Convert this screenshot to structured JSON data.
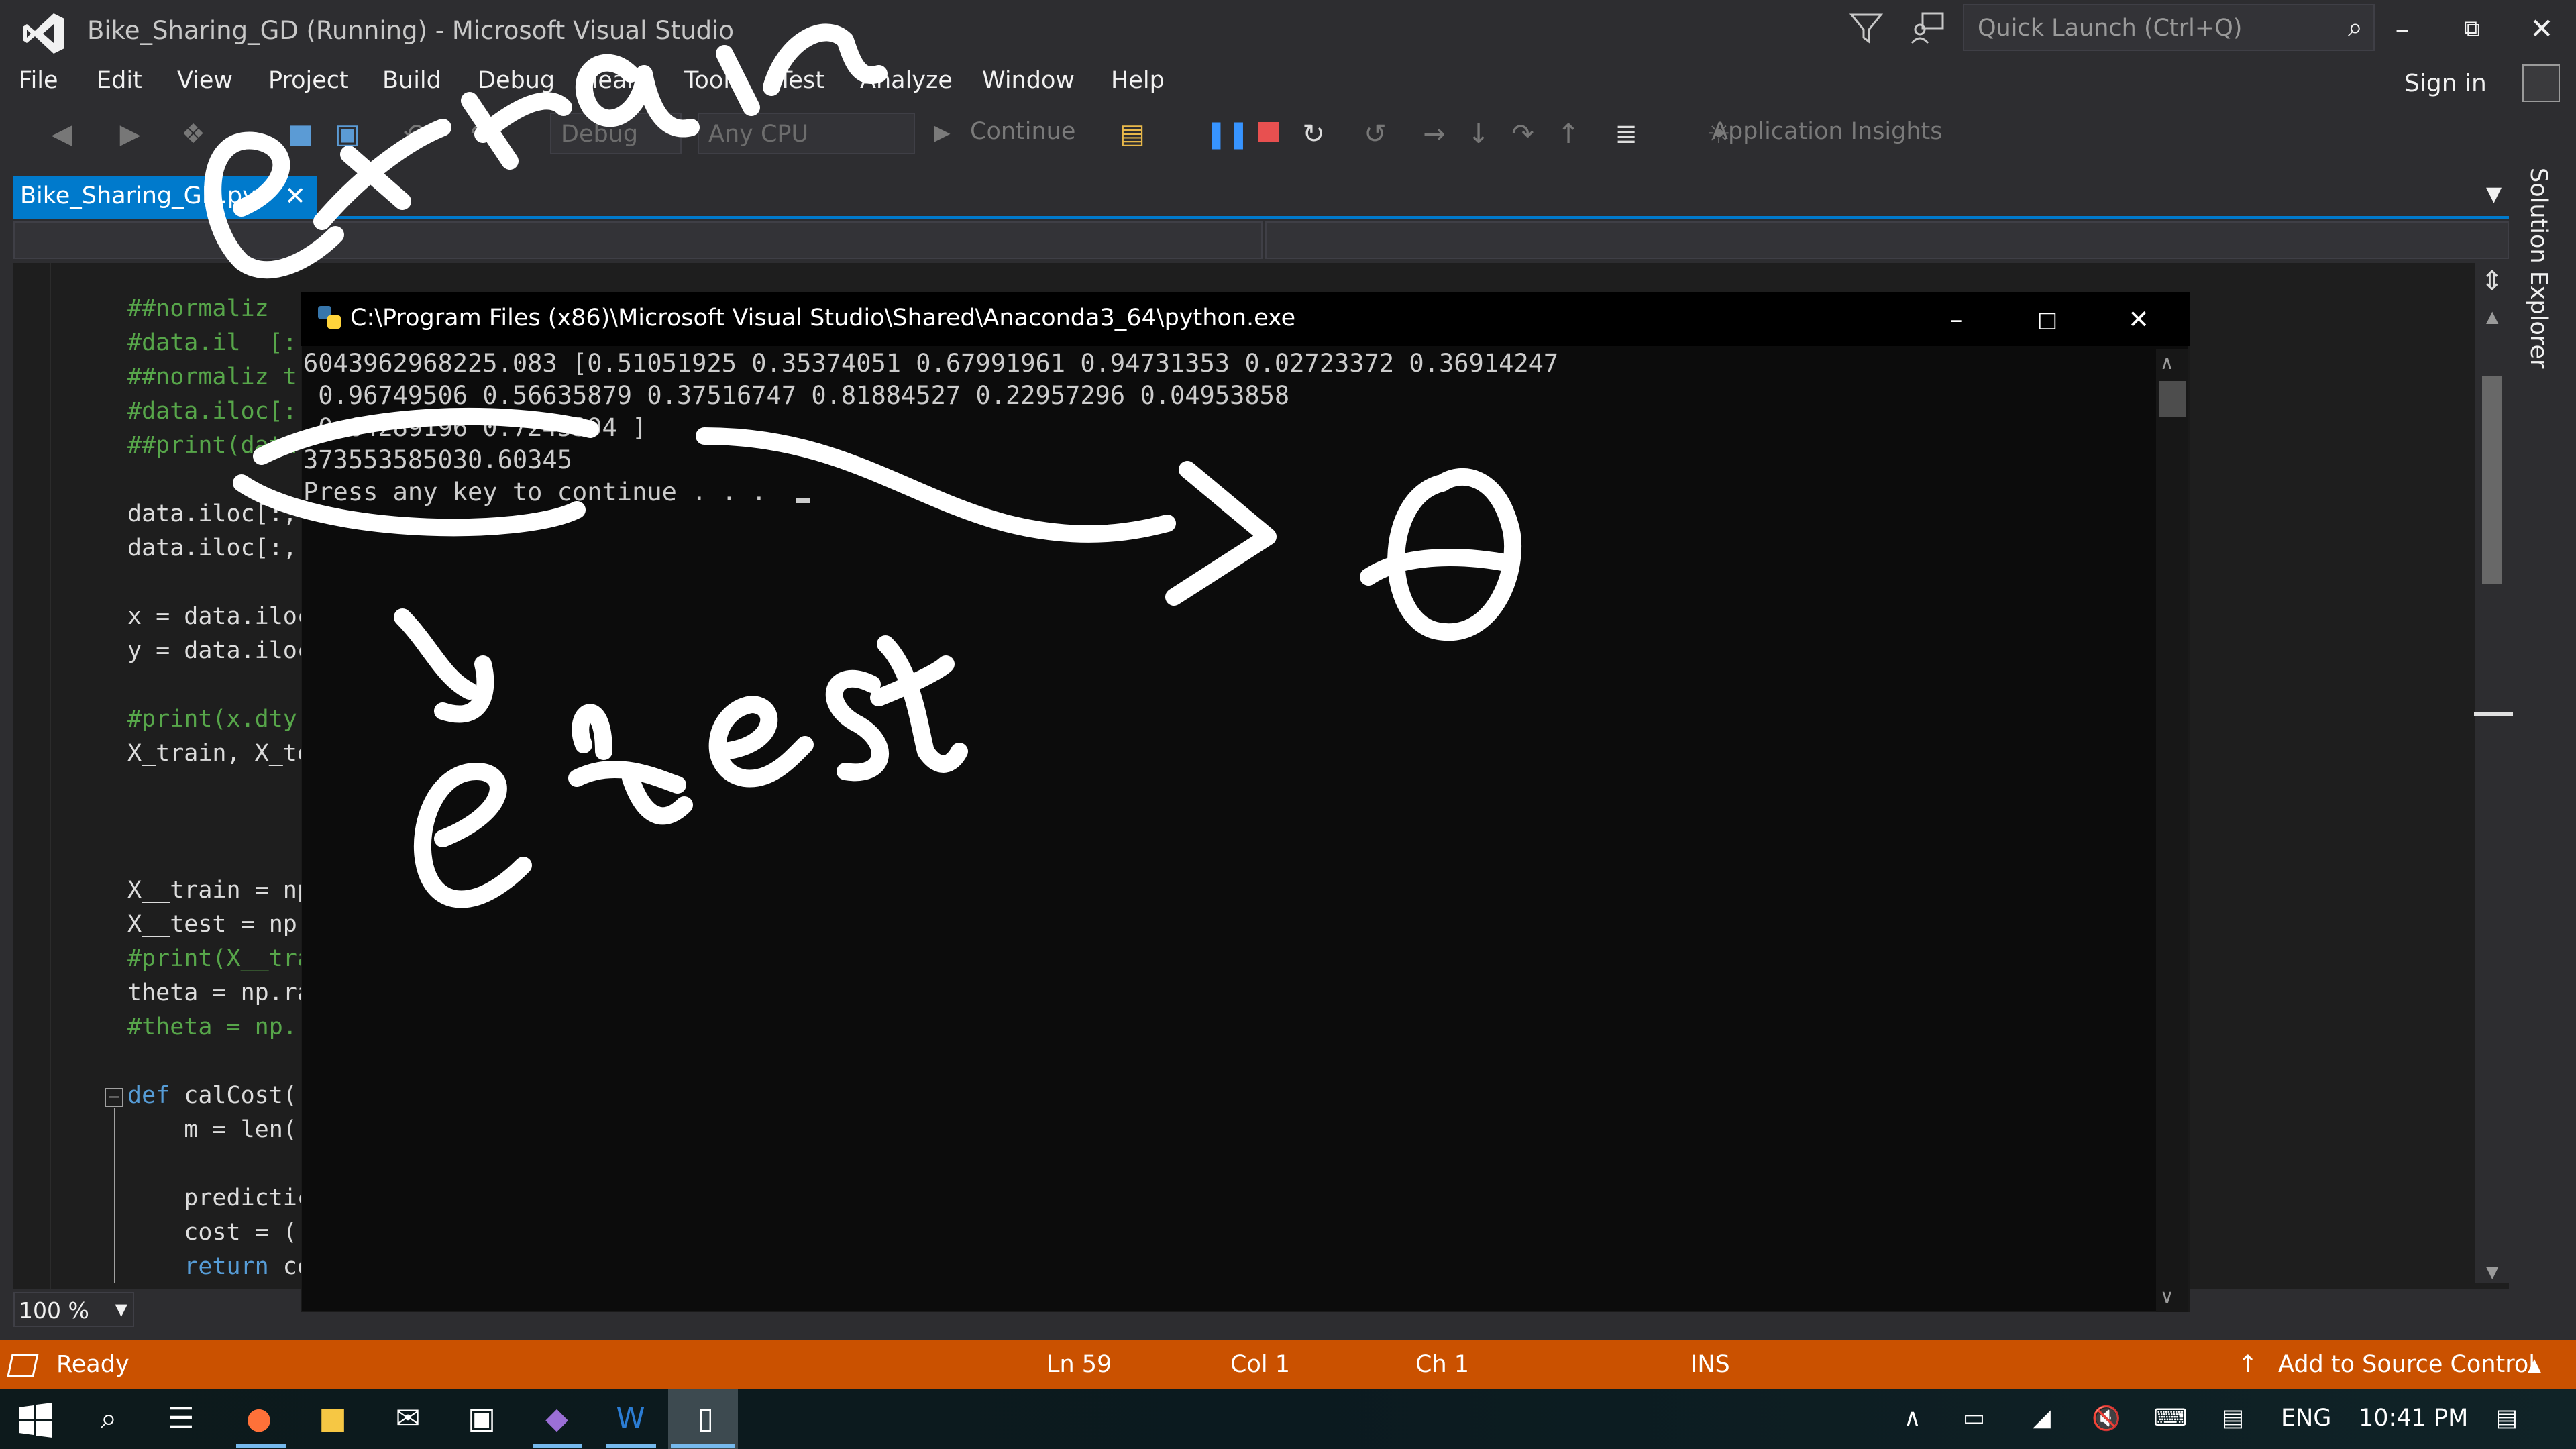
{
  "window": {
    "title": "Bike_Sharing_GD (Running) - Microsoft Visual Studio",
    "quick_launch_placeholder": "Quick Launch (Ctrl+Q)",
    "sign_in": "Sign in"
  },
  "menu": [
    "File",
    "Edit",
    "View",
    "Project",
    "Build",
    "Debug",
    "Team",
    "Tools",
    "Test",
    "Analyze",
    "Window",
    "Help"
  ],
  "toolbar": {
    "config": "Debug",
    "platform": "Any CPU",
    "continue": "Continue",
    "app_insights": "Application Insights"
  },
  "tab": {
    "label": "Bike_Sharing_GD.py"
  },
  "solution_explorer": "Solution Explorer",
  "code_lines": [
    {
      "text": "##normaliz",
      "kind": "comment"
    },
    {
      "text": "#data.il  [:",
      "kind": "comment"
    },
    {
      "text": "##normaliz t",
      "kind": "comment"
    },
    {
      "text": "#data.iloc[:",
      "kind": "comment"
    },
    {
      "text": "##print(data",
      "kind": "comment"
    },
    {
      "text": "",
      "kind": "plain"
    },
    {
      "text": "data.iloc[:,",
      "kind": "plain"
    },
    {
      "text": "data.iloc[:,",
      "kind": "plain"
    },
    {
      "text": "",
      "kind": "plain"
    },
    {
      "text": "x = data.iloc",
      "kind": "plain"
    },
    {
      "text": "y = data.iloc",
      "kind": "plain"
    },
    {
      "text": "",
      "kind": "plain"
    },
    {
      "text": "#print(x.dty",
      "kind": "comment"
    },
    {
      "text": "X_train, X_te",
      "kind": "plain"
    },
    {
      "text": "",
      "kind": "plain"
    },
    {
      "text": "",
      "kind": "plain"
    },
    {
      "text": "",
      "kind": "plain"
    },
    {
      "text": "X__train = np",
      "kind": "plain"
    },
    {
      "text": "X__test = np.",
      "kind": "plain"
    },
    {
      "text": "#print(X__tra",
      "kind": "comment"
    },
    {
      "text": "theta = np.ra",
      "kind": "plain"
    },
    {
      "text": "#theta = np.",
      "kind": "comment"
    },
    {
      "text": "",
      "kind": "plain"
    },
    {
      "text": "def calCost(",
      "kind": "def"
    },
    {
      "text": "    m = len(",
      "kind": "plain"
    },
    {
      "text": "",
      "kind": "plain"
    },
    {
      "text": "    predictic",
      "kind": "plain"
    },
    {
      "text": "    cost = (",
      "kind": "plain"
    },
    {
      "text": "    return co",
      "kind": "return"
    }
  ],
  "zoom": "100 %",
  "console": {
    "title": "C:\\Program Files (x86)\\Microsoft Visual Studio\\Shared\\Anaconda3_64\\python.exe",
    "lines": [
      "6043962968225.083 [0.51051925 0.35374051 0.67991961 0.94731353 0.02723372 0.36914247",
      " 0.96749506 0.56635879 0.37516747 0.81884527 0.22957296 0.04953858",
      " 0.64289196 0.7245394 ]",
      "373553585030.60345",
      "Press any key to continue . . . "
    ]
  },
  "status": {
    "ready": "Ready",
    "ln": "Ln 59",
    "col": "Col 1",
    "ch": "Ch 1",
    "ins": "INS",
    "source_control": "Add to Source Control"
  },
  "taskbar": {
    "lang": "ENG",
    "time": "10:41 PM"
  },
  "colors": {
    "accent": "#007acc",
    "status_bar": "#ca5100",
    "comment": "#57a64a",
    "keyword": "#569cd6"
  }
}
